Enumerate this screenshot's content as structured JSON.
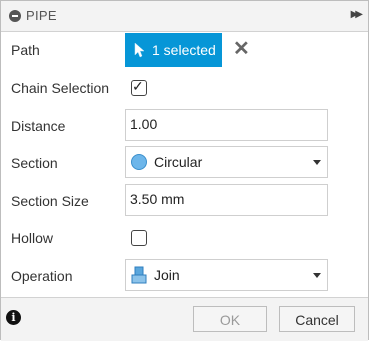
{
  "dialog": {
    "title": "PIPE",
    "expand_icon": "double-chevron-right-icon"
  },
  "rows": {
    "path": {
      "label": "Path",
      "selection_text": "1 selected",
      "clear_icon": "close-icon"
    },
    "chain_selection": {
      "label": "Chain Selection",
      "checked": true
    },
    "distance": {
      "label": "Distance",
      "value": "1.00"
    },
    "section": {
      "label": "Section",
      "value": "Circular",
      "icon": "circle-icon"
    },
    "section_size": {
      "label": "Section Size",
      "value": "3.50 mm"
    },
    "hollow": {
      "label": "Hollow",
      "checked": false
    },
    "operation": {
      "label": "Operation",
      "value": "Join",
      "icon": "join-icon"
    }
  },
  "footer": {
    "info_icon": "info-icon",
    "ok_label": "OK",
    "cancel_label": "Cancel"
  },
  "colors": {
    "accent": "#0696d7",
    "section_icon": "#6db6ea",
    "join_icon": "#5aa6dc"
  }
}
